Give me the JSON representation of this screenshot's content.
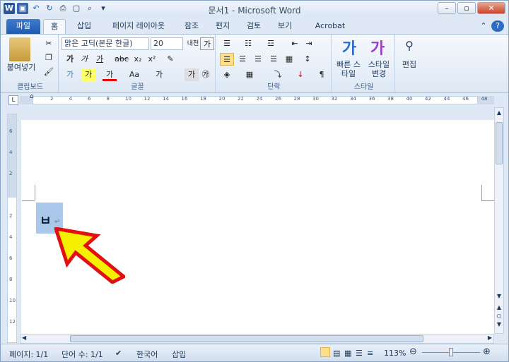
{
  "title": "문서1 - Microsoft Word",
  "tabs": [
    "파일",
    "홈",
    "삽입",
    "페이지 레이아웃",
    "참조",
    "편지",
    "검토",
    "보기",
    "Acrobat"
  ],
  "clipboard": {
    "paste": "붙여넣기",
    "label": "클립보드"
  },
  "font": {
    "name": "맑은 고딕(본문 한글)",
    "size": "20",
    "label": "글꼴",
    "bold": "가",
    "italic": "가",
    "underline": "가",
    "strike": "abc",
    "sub": "x₂",
    "sup": "x²",
    "grow": "가",
    "shrink": "가",
    "case": "Aa",
    "clear": "가",
    "phonetic": "가",
    "enclose": "㉮",
    "highlight": "가",
    "color": "가",
    "ganada": "내천"
  },
  "paragraph": {
    "label": "단락"
  },
  "styles": {
    "quick": "빠른 스타일",
    "change": "스타일 변경",
    "label": "스타일",
    "glyph1": "가",
    "glyph2": "가"
  },
  "edit": {
    "label": "편집"
  },
  "ruler": [
    "2",
    "4",
    "6",
    "8",
    "10",
    "12",
    "14",
    "16",
    "18",
    "20",
    "22",
    "24",
    "26",
    "28",
    "30",
    "32",
    "34",
    "36",
    "38",
    "40",
    "42",
    "44",
    "46",
    "48"
  ],
  "vruler": [
    "6",
    "4",
    "2",
    "",
    "2",
    "4",
    "6",
    "8",
    "10",
    "12"
  ],
  "document": {
    "glyph": "ㅂ",
    "para": "↵"
  },
  "status": {
    "page": "페이지: 1/1",
    "words": "단어 수: 1/1",
    "lang": "한국어",
    "insert": "삽입",
    "zoom": "113%"
  }
}
